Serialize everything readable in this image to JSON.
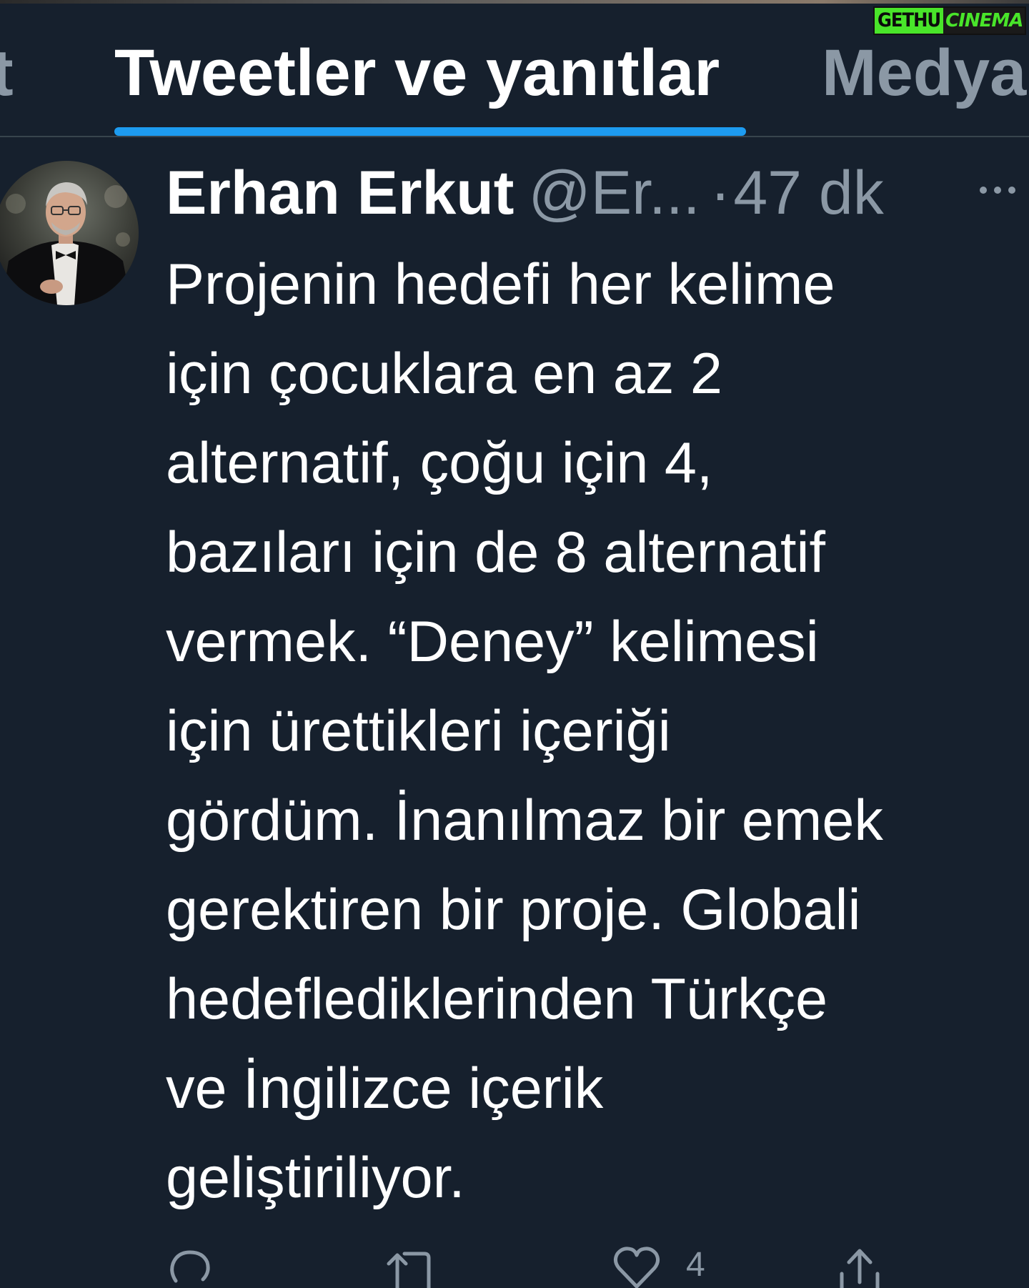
{
  "watermark": {
    "left_text": "GETHU",
    "right_text": "CINEMA"
  },
  "tabs": [
    {
      "label": "t",
      "active": false
    },
    {
      "label": "Tweetler ve yanıtlar",
      "active": true
    },
    {
      "label": "Medya",
      "active": false
    }
  ],
  "tweet": {
    "author_name": "Erhan Erkut",
    "handle": "@Er...",
    "separator": "·",
    "timestamp": "47 dk",
    "more_label": "•••",
    "body_lines": [
      "Projenin hedefi her kelime",
      "için çocuklara en az 2",
      "alternatif, çoğu için 4,",
      "bazıları için de 8 alternatif",
      "vermek. “Deney” kelimesi",
      "için ürettikleri içeriği",
      "gördüm. İnanılmaz bir emek",
      "gerektiren bir proje. Globali",
      "hedeflediklerinden Türkçe",
      "ve İngilizce içerik",
      "geliştiriliyor."
    ],
    "actions": {
      "reply_icon": "reply-icon",
      "retweet_icon": "retweet-icon",
      "like_icon": "heart-icon",
      "like_count": "4",
      "share_icon": "share-icon"
    }
  },
  "colors": {
    "background": "#16202d",
    "accent": "#1d9bf0",
    "secondary_text": "#8b98a5",
    "watermark_green": "#49e52a"
  }
}
